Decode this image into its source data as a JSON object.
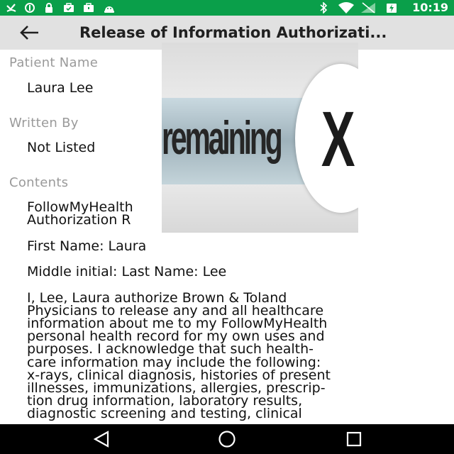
{
  "status_bar": {
    "time": "10:19",
    "left_icons": [
      "missed-call-icon",
      "data-saver-icon",
      "lock-icon",
      "briefcase-check-icon",
      "briefcase-icon",
      "android-icon"
    ],
    "right_icons": [
      "bluetooth-icon",
      "wifi-icon",
      "no-signal-icon",
      "battery-charging-icon"
    ],
    "background_color": "#0a9f4a"
  },
  "app_bar": {
    "title": "Release of Information Authorizati..."
  },
  "fields": {
    "patient_name_label": "Patient Name",
    "patient_name_value": "Laura Lee",
    "written_by_label": "Written By",
    "written_by_value": "Not Listed",
    "contents_label": "Contents"
  },
  "contents": {
    "line1": "FollowMyHealth",
    "line2": "Authorization R",
    "first_name": "First Name: Laura",
    "middle_last": "Middle initial:  Last Name: Lee",
    "body_lines": [
      "I, Lee, Laura  authorize Brown & Toland",
      "Physicians to release any and all healthcare",
      "information about me to my FollowMyHealth",
      "personal health record for my own uses and",
      "purposes. I acknowledge that such health-",
      "care information may include the following:",
      "x-rays, clinical diagnosis, histories of present",
      "illnesses, immunizations, allergies, prescrip-",
      "tion drug information, laboratory results,",
      "diagnostic screening and testing, clinical"
    ]
  },
  "overlay": {
    "text": "remaining",
    "close_glyph": "X"
  },
  "nav_bar": {
    "buttons": [
      "back-triangle-icon",
      "home-circle-icon",
      "recents-square-icon"
    ]
  }
}
